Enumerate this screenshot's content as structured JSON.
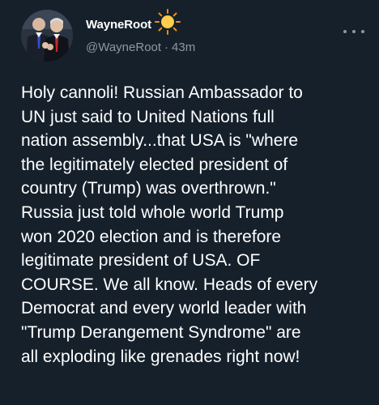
{
  "author": {
    "display_name": "WayneRoot",
    "handle": "@WayneRoot",
    "separator": "·",
    "time": "43m",
    "verified_emoji": "sun-emoji"
  },
  "tweet": {
    "lines": [
      "Holy cannoli! Russian Ambassador to",
      "UN just said to United Nations full",
      "nation assembly...that USA is \"where",
      "the legitimately elected president of",
      "country (Trump) was overthrown.\"",
      "Russia just told whole world Trump",
      "won 2020 election and is therefore",
      "legitimate president of USA. OF",
      "COURSE. We all know. Heads of every",
      "Democrat and every world leader with",
      "\"Trump Derangement Syndrome\" are",
      "all exploding like grenades right now!"
    ]
  },
  "colors": {
    "background": "#15202b",
    "primary_text": "#ffffff",
    "secondary_text": "#8b98a5"
  }
}
